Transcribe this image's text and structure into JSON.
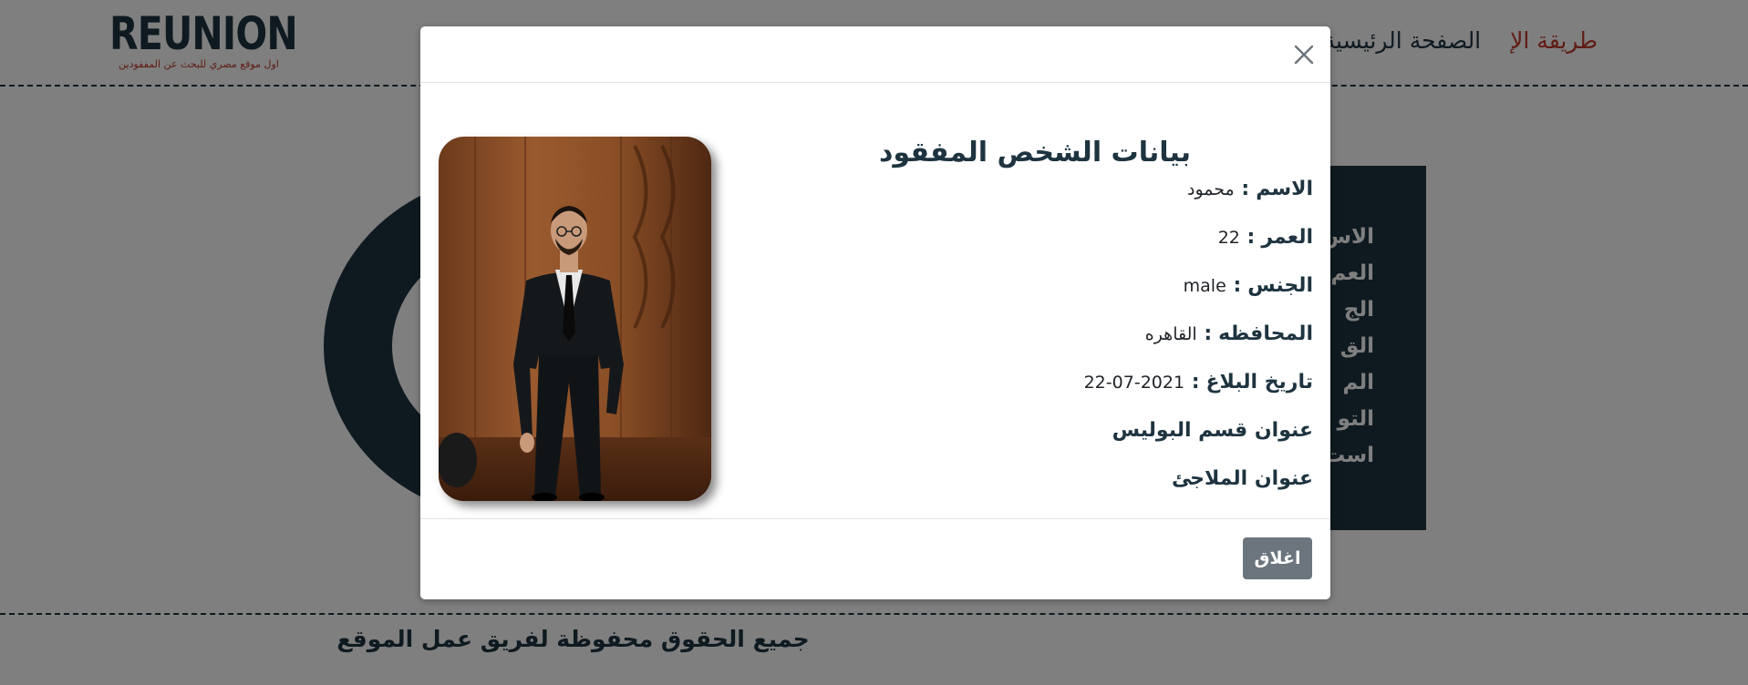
{
  "brand": {
    "name": "REUNION",
    "tagline": "اول موقع مصري للبحث عن المفقودين",
    "brand_color": "#1e3440",
    "accent_color": "#c0392b"
  },
  "nav": {
    "items": [
      {
        "label": "الصفحة الرئيسية",
        "active": false
      },
      {
        "label": "طريقة الإ",
        "active": true
      }
    ]
  },
  "background_panel": {
    "lines": [
      "الاس",
      "العم",
      "الج",
      "الق",
      "الم",
      "التو",
      "است"
    ]
  },
  "footer": {
    "copyright": "جميع الحقوق محفوظة لفريق عمل الموقع"
  },
  "modal": {
    "close_icon": "close-icon",
    "title": "بيانات الشخص المفقود",
    "fields": [
      {
        "label": "الاسم",
        "separator": ":",
        "value": "محمود"
      },
      {
        "label": "العمر",
        "separator": ":",
        "value": "22"
      },
      {
        "label": "الجنس",
        "separator": ":",
        "value": "male"
      },
      {
        "label": "المحافظه",
        "separator": ":",
        "value": "القاهره"
      },
      {
        "label": "تاريخ البلاغ",
        "separator": ":",
        "value": "2021-07-22"
      }
    ],
    "links": [
      {
        "label": "عنوان قسم البوليس"
      },
      {
        "label": "عنوان الملاجئ"
      }
    ],
    "close_button_label": "اغلاق",
    "close_button_color": "#6c757d"
  }
}
